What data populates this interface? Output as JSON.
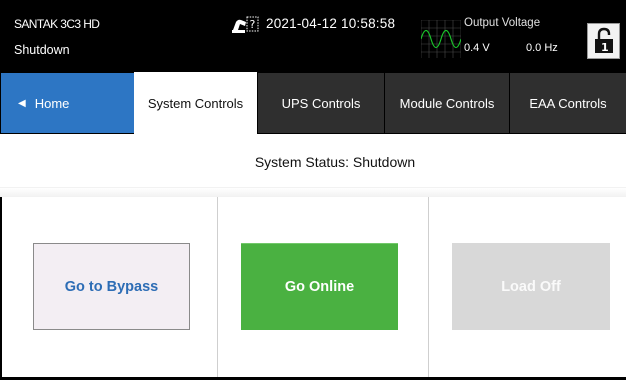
{
  "header": {
    "device_name": "SANTAK 3C3 HD",
    "device_state": "Shutdown",
    "datetime": "2021-04-12 10:58:58",
    "output_title": "Output Voltage",
    "output_voltage": "0.4 V",
    "output_frequency": "0.0 Hz",
    "alarm_icon": "alarm-question-icon",
    "lock_icon": "unlock-level-1-icon",
    "lock_level": "1"
  },
  "tabs": [
    {
      "label": "Home",
      "active": false,
      "icon": "left-triangle-icon"
    },
    {
      "label": "System Controls",
      "active": true
    },
    {
      "label": "UPS Controls",
      "active": false
    },
    {
      "label": "Module Controls",
      "active": false
    },
    {
      "label": "EAA Controls",
      "active": false
    }
  ],
  "status": {
    "label": "System Status:",
    "value": "Shutdown"
  },
  "actions": [
    {
      "label": "Go to Bypass",
      "enabled": true
    },
    {
      "label": "Go Online",
      "enabled": true
    },
    {
      "label": "Load Off",
      "enabled": false
    }
  ],
  "colors": {
    "home_tab": "#2d76c4",
    "go_online": "#4ab141",
    "bypass_text": "#2d6db5",
    "disabled": "#d8d8d8"
  }
}
